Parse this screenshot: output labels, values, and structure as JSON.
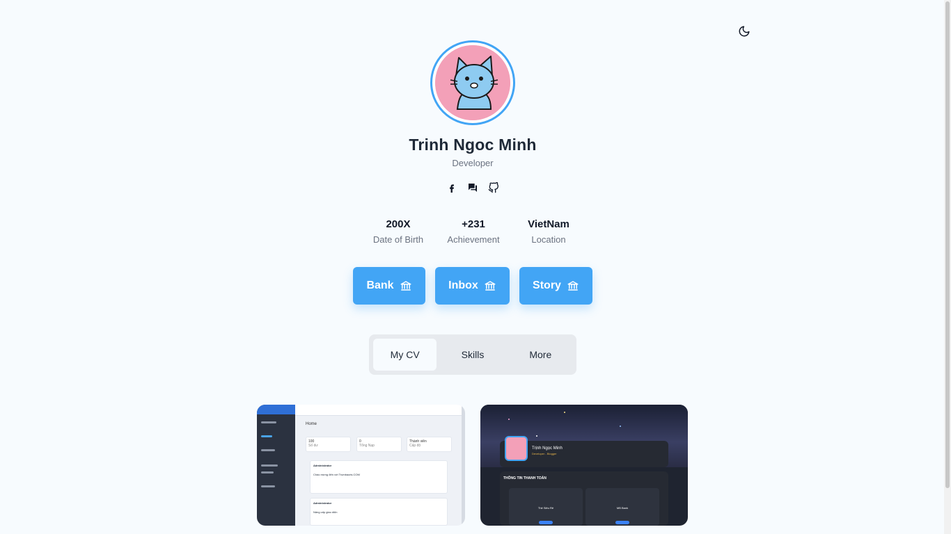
{
  "profile": {
    "name": "Trinh Ngoc Minh",
    "role": "Developer"
  },
  "icons": {
    "theme_toggle": "moon-icon",
    "socials": [
      "facebook-icon",
      "chat-icon",
      "github-icon"
    ],
    "action_buttons": "bank-icon"
  },
  "stats": [
    {
      "value": "200X",
      "label": "Date of Birth"
    },
    {
      "value": "+231",
      "label": "Achievement"
    },
    {
      "value": "VietNam",
      "label": "Location"
    }
  ],
  "actions": [
    {
      "label": "Bank"
    },
    {
      "label": "Inbox"
    },
    {
      "label": "Story"
    }
  ],
  "tabs": [
    {
      "label": "My CV",
      "active": true
    },
    {
      "label": "Skills",
      "active": false
    },
    {
      "label": "More",
      "active": false
    }
  ],
  "previews": {
    "first": {
      "title": "Home",
      "cards": [
        {
          "value": "100",
          "label": "Số dư"
        },
        {
          "value": "0",
          "label": "Tổng Nạp"
        },
        {
          "value": "Thành viên",
          "label": "Cấp độ"
        }
      ],
      "posts": [
        {
          "author": "Administrator",
          "text": "Chào mừng đến với Trumbacris.COM"
        },
        {
          "author": "Administrator",
          "text": "Nâng cấp giao diện"
        }
      ]
    },
    "second": {
      "name": "Trịnh Ngọc Minh",
      "subtitle": "Developer - Blogger",
      "heading": "THÔNG TIN THANH TOÁN",
      "banks": [
        "Thẻ Siêu Rẻ",
        "MB Bank"
      ]
    }
  },
  "colors": {
    "accent": "#42a5f5",
    "background": "#f7fbfe",
    "tab_track": "#e7eaee"
  }
}
